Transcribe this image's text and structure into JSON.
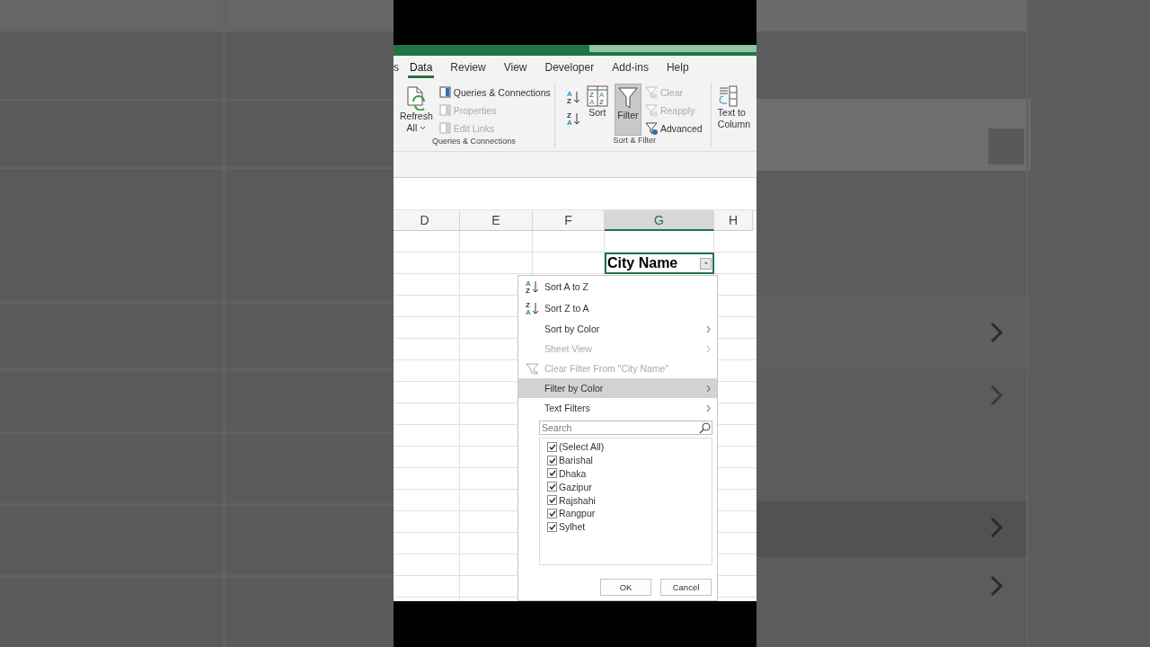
{
  "ribbon": {
    "tabs": [
      {
        "label": "s",
        "selected": false
      },
      {
        "label": "Data",
        "selected": true
      },
      {
        "label": "Review",
        "selected": false
      },
      {
        "label": "View",
        "selected": false
      },
      {
        "label": "Developer",
        "selected": false
      },
      {
        "label": "Add-ins",
        "selected": false
      },
      {
        "label": "Help",
        "selected": false
      }
    ],
    "groups": [
      {
        "label": "Queries & Connections",
        "refresh": [
          "Refresh",
          "All"
        ],
        "items": [
          {
            "label": "Queries & Connections",
            "disabled": false
          },
          {
            "label": "Properties",
            "disabled": true
          },
          {
            "label": "Edit Links",
            "disabled": true
          }
        ]
      },
      {
        "label": "Sort & Filter",
        "sort_icons": [
          [
            "A",
            "Z"
          ],
          [
            "Z",
            "A"
          ]
        ],
        "sort_dialog_icon": [
          "Z",
          "A",
          "A",
          "Z"
        ],
        "sort": "Sort",
        "filter": {
          "label": "Filter",
          "selected": true
        },
        "items": [
          {
            "label": "Clear",
            "disabled": true
          },
          {
            "label": "Reapply",
            "disabled": true
          },
          {
            "label": "Advanced",
            "disabled": false
          }
        ]
      },
      {
        "text_to_columns": [
          "Text to",
          "Column"
        ]
      }
    ]
  },
  "sheet": {
    "columns": [
      {
        "label": "D",
        "selected": false
      },
      {
        "label": "E",
        "selected": false
      },
      {
        "label": "F",
        "selected": false
      },
      {
        "label": "G",
        "selected": true
      },
      {
        "label": "H",
        "selected": false
      }
    ],
    "header_cell": "City Name"
  },
  "filter_menu": {
    "items": [
      {
        "kind": "sort-asc",
        "icon": [
          "A",
          "Z"
        ],
        "label": "Sort A to Z",
        "disabled": false,
        "highlighted": false
      },
      {
        "kind": "sort-desc",
        "icon": [
          "Z",
          "A"
        ],
        "label": "Sort Z to A",
        "disabled": false,
        "highlighted": false
      },
      {
        "kind": "submenu",
        "label": "Sort by Color",
        "disabled": false,
        "highlighted": false
      },
      {
        "kind": "submenu",
        "label": "Sheet View",
        "disabled": true,
        "highlighted": false
      },
      {
        "kind": "clear",
        "label": "Clear Filter From \"City Name\"",
        "disabled": true,
        "highlighted": false
      },
      {
        "kind": "submenu",
        "label": "Filter by Color",
        "disabled": false,
        "highlighted": true
      },
      {
        "kind": "submenu",
        "label": "Text Filters",
        "disabled": false,
        "highlighted": false
      }
    ],
    "search": {
      "placeholder": "Search"
    },
    "values": [
      {
        "label": "(Select All)",
        "checked": true
      },
      {
        "label": "Barishal",
        "checked": true
      },
      {
        "label": "Dhaka",
        "checked": true
      },
      {
        "label": "Gazipur",
        "checked": true
      },
      {
        "label": "Rajshahi",
        "checked": true
      },
      {
        "label": "Rangpur",
        "checked": true
      },
      {
        "label": "Sylhet",
        "checked": true
      }
    ],
    "buttons": [
      "OK",
      "Cancel"
    ]
  }
}
